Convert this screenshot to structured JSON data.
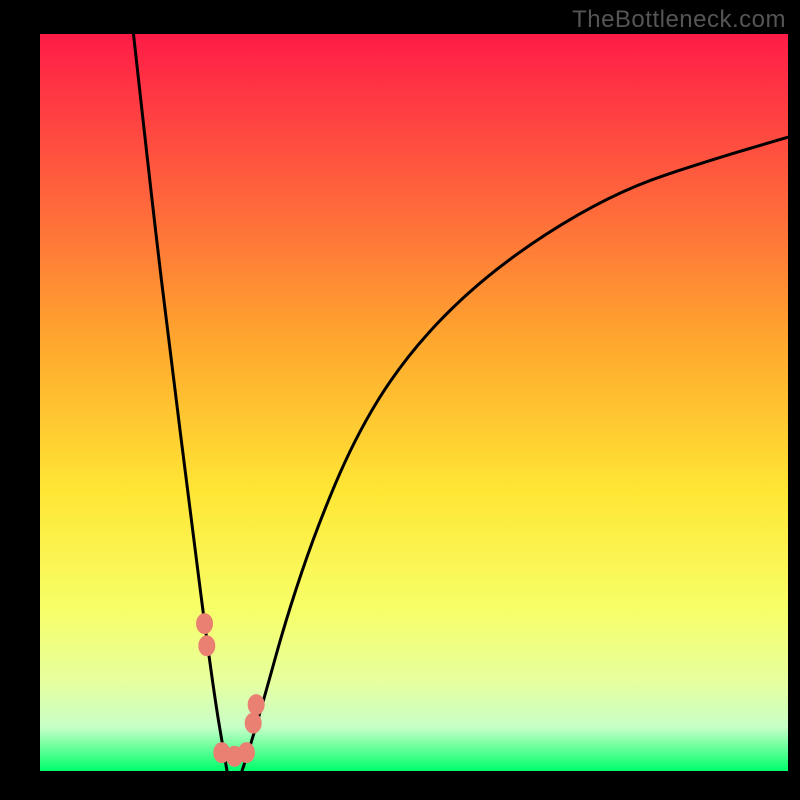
{
  "watermark": "TheBottleneck.com",
  "colors": {
    "background": "#000000",
    "gradient": {
      "top": "#ff1c47",
      "mid1": "#ff643c",
      "mid2": "#ffa82e",
      "mid3": "#ffe634",
      "mid4": "#f7ff68",
      "mid5": "#e4ffb0",
      "bottom": "#00ff6a"
    },
    "curve_stroke": "#000000",
    "marker_fill": "#e98072",
    "marker_stroke": "#e98072"
  },
  "chart_data": {
    "type": "line",
    "title": "",
    "xlabel": "",
    "ylabel": "",
    "xlim": [
      0,
      100
    ],
    "ylim": [
      0,
      100
    ],
    "series": [
      {
        "name": "left-curve",
        "x": [
          12.5,
          15,
          17.5,
          20,
          22,
          23.5,
          24.5,
          25
        ],
        "y": [
          100,
          77,
          56,
          36,
          20,
          9,
          3,
          0
        ]
      },
      {
        "name": "right-curve",
        "x": [
          27,
          28,
          30,
          33,
          37,
          42,
          48,
          56,
          66,
          78,
          90,
          100
        ],
        "y": [
          0,
          3,
          10,
          21,
          33,
          45,
          55,
          64,
          72,
          79,
          83,
          86
        ]
      }
    ],
    "markers": [
      {
        "x": 22.0,
        "y": 20,
        "name": "left-upper-marker"
      },
      {
        "x": 22.3,
        "y": 17,
        "name": "left-upper-marker-2"
      },
      {
        "x": 24.3,
        "y": 2.5,
        "name": "valley-left-marker"
      },
      {
        "x": 26.0,
        "y": 2.0,
        "name": "valley-center-marker"
      },
      {
        "x": 27.6,
        "y": 2.5,
        "name": "valley-right-marker"
      },
      {
        "x": 28.5,
        "y": 6.5,
        "name": "right-upper-marker"
      },
      {
        "x": 28.9,
        "y": 9.0,
        "name": "right-upper-marker-2"
      }
    ]
  }
}
